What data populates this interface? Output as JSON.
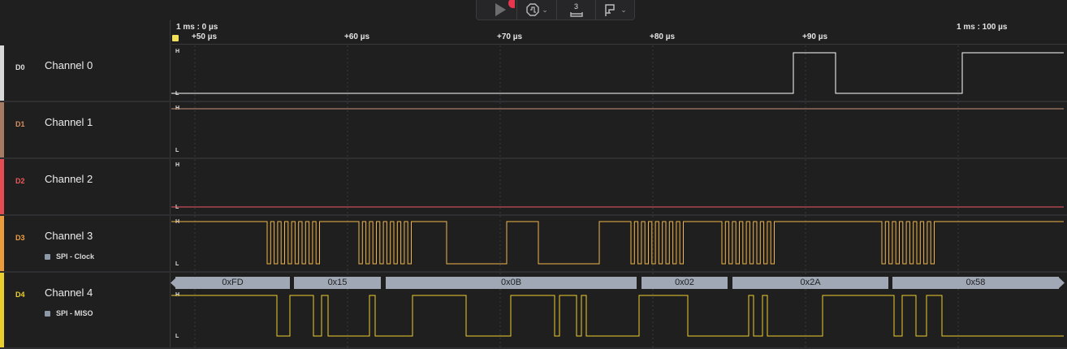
{
  "ruler": {
    "start_label": "1 ms : 0 µs",
    "end_label": "1 ms : 100 µs",
    "ticks": [
      "+50 µs",
      "+60 µs",
      "+70 µs",
      "+80 µs",
      "+90 µs"
    ]
  },
  "level_labels": {
    "high": "H",
    "low": "L"
  },
  "channels": [
    {
      "id": "D0",
      "name": "Channel 0",
      "color": "#d8d8d8",
      "id_color": "#e0e0e0",
      "wave_color": "#ffffff"
    },
    {
      "id": "D1",
      "name": "Channel 1",
      "color": "#a57a62",
      "id_color": "#d88f60",
      "wave_color": "#c8957a"
    },
    {
      "id": "D2",
      "name": "Channel 2",
      "color": "#e64a55",
      "id_color": "#ee5a5a",
      "wave_color": "#ef5a64"
    },
    {
      "id": "D3",
      "name": "Channel 3",
      "color": "#eb9b3c",
      "id_color": "#f0a040",
      "wave_color": "#f2b44a",
      "analyzer": "SPI - Clock"
    },
    {
      "id": "D4",
      "name": "Channel 4",
      "color": "#e9cf2c",
      "id_color": "#ecd12f",
      "wave_color": "#efce2c",
      "analyzer": "SPI - MISO"
    }
  ],
  "decoded_bytes": [
    "0xFD",
    "0x15",
    "0x0B",
    "0x02",
    "0x2A",
    "0x58"
  ],
  "toolbar": {
    "icons": [
      "play-icon",
      "record-icon",
      "trigger-icon",
      "measure-icon",
      "marker-icon"
    ],
    "measure_badge": "3",
    "accent": "#e8364f"
  }
}
